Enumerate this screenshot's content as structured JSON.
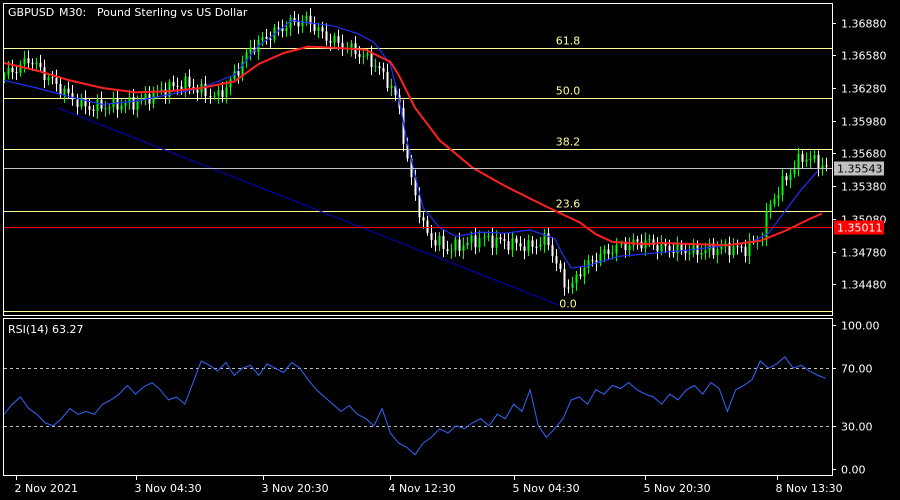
{
  "symbol": "GBPUSD",
  "timeframe": "M30:",
  "description": "Pound Sterling vs US Dollar",
  "colors": {
    "background": "#000000",
    "frame": "#ffffff",
    "bull_candle": "#00ff00",
    "bear_candle": "#ffffff",
    "ma_slow": "#ff2020",
    "ma_fast": "#2030ff",
    "fibonacci": "#ffff99",
    "trendline": "#0000cc",
    "rsi": "#3366ff",
    "bid_line": "#c0c0c0",
    "ask_line": "#ff0000",
    "ask_label_bg": "#ff0000"
  },
  "chart_data": [
    {
      "type": "candlestick",
      "title": "GBPUSD, M30:  Pound Sterling vs US Dollar",
      "ylim": [
        1.342,
        1.3705
      ],
      "y_ticks": [
        "1.36880",
        "1.36580",
        "1.36280",
        "1.35980",
        "1.35680",
        "1.35380",
        "1.35080",
        "1.34780",
        "1.34480"
      ],
      "x_range": [
        0,
        100
      ],
      "close_path": [
        [
          0,
          1.364
        ],
        [
          2,
          1.3648
        ],
        [
          3,
          1.3655
        ],
        [
          5,
          1.364
        ],
        [
          8,
          1.362
        ],
        [
          10,
          1.361
        ],
        [
          13,
          1.3612
        ],
        [
          16,
          1.3615
        ],
        [
          18,
          1.3622
        ],
        [
          20,
          1.3628
        ],
        [
          22,
          1.3632
        ],
        [
          24,
          1.3625
        ],
        [
          26,
          1.362
        ],
        [
          28,
          1.364
        ],
        [
          30,
          1.3665
        ],
        [
          33,
          1.368
        ],
        [
          35,
          1.3688
        ],
        [
          37,
          1.369
        ],
        [
          39,
          1.3675
        ],
        [
          41,
          1.3668
        ],
        [
          43,
          1.366
        ],
        [
          45,
          1.365
        ],
        [
          47,
          1.363
        ],
        [
          48,
          1.361
        ],
        [
          49,
          1.356
        ],
        [
          50,
          1.353
        ],
        [
          51,
          1.35
        ],
        [
          52,
          1.349
        ],
        [
          54,
          1.348
        ],
        [
          56,
          1.3485
        ],
        [
          58,
          1.349
        ],
        [
          60,
          1.3488
        ],
        [
          62,
          1.3485
        ],
        [
          64,
          1.3482
        ],
        [
          66,
          1.349
        ],
        [
          67,
          1.347
        ],
        [
          68,
          1.345
        ],
        [
          69,
          1.3445
        ],
        [
          70,
          1.346
        ],
        [
          72,
          1.3472
        ],
        [
          74,
          1.348
        ],
        [
          76,
          1.3485
        ],
        [
          78,
          1.3487
        ],
        [
          80,
          1.3482
        ],
        [
          82,
          1.348
        ],
        [
          84,
          1.3478
        ],
        [
          86,
          1.348
        ],
        [
          88,
          1.3482
        ],
        [
          90,
          1.348
        ],
        [
          92,
          1.349
        ],
        [
          93,
          1.352
        ],
        [
          95,
          1.3545
        ],
        [
          97,
          1.3565
        ],
        [
          99,
          1.356
        ],
        [
          100,
          1.3554
        ]
      ],
      "ma_slow": [
        [
          0,
          1.3651
        ],
        [
          4,
          1.3644
        ],
        [
          8,
          1.3635
        ],
        [
          12,
          1.3628
        ],
        [
          16,
          1.3624
        ],
        [
          20,
          1.3625
        ],
        [
          24,
          1.3628
        ],
        [
          28,
          1.3634
        ],
        [
          31,
          1.365
        ],
        [
          34,
          1.366
        ],
        [
          37,
          1.3666
        ],
        [
          40,
          1.3665
        ],
        [
          44,
          1.3663
        ],
        [
          47,
          1.3652
        ],
        [
          48,
          1.364
        ],
        [
          50,
          1.361
        ],
        [
          53,
          1.358
        ],
        [
          57,
          1.3555
        ],
        [
          61,
          1.3538
        ],
        [
          65,
          1.3523
        ],
        [
          68,
          1.3512
        ],
        [
          70,
          1.3505
        ],
        [
          72,
          1.3494
        ],
        [
          74,
          1.3487
        ],
        [
          76,
          1.3486
        ],
        [
          78,
          1.3485
        ],
        [
          80,
          1.3486
        ],
        [
          84,
          1.3485
        ],
        [
          88,
          1.3484
        ],
        [
          92,
          1.3488
        ],
        [
          95,
          1.3497
        ],
        [
          98,
          1.3508
        ],
        [
          99.5,
          1.3513
        ]
      ],
      "ma_fast": [
        [
          0,
          1.3635
        ],
        [
          4,
          1.3628
        ],
        [
          8,
          1.362
        ],
        [
          12,
          1.3613
        ],
        [
          16,
          1.3616
        ],
        [
          20,
          1.3622
        ],
        [
          24,
          1.3628
        ],
        [
          28,
          1.364
        ],
        [
          31,
          1.3667
        ],
        [
          33,
          1.3678
        ],
        [
          35,
          1.369
        ],
        [
          37,
          1.3688
        ],
        [
          40,
          1.3685
        ],
        [
          43,
          1.3678
        ],
        [
          45,
          1.367
        ],
        [
          47,
          1.365
        ],
        [
          48,
          1.362
        ],
        [
          49,
          1.358
        ],
        [
          50,
          1.3548
        ],
        [
          51,
          1.3518
        ],
        [
          53,
          1.35
        ],
        [
          55,
          1.3492
        ],
        [
          58,
          1.3496
        ],
        [
          61,
          1.3495
        ],
        [
          64,
          1.3498
        ],
        [
          67,
          1.349
        ],
        [
          68,
          1.3475
        ],
        [
          69,
          1.3463
        ],
        [
          71,
          1.3465
        ],
        [
          73,
          1.347
        ],
        [
          75,
          1.3474
        ],
        [
          78,
          1.3476
        ],
        [
          81,
          1.3478
        ],
        [
          84,
          1.348
        ],
        [
          88,
          1.3484
        ],
        [
          91,
          1.3487
        ],
        [
          93,
          1.3495
        ],
        [
          95,
          1.3515
        ],
        [
          97,
          1.3535
        ],
        [
          99,
          1.3552
        ]
      ],
      "trendline": [
        [
          6.5,
          1.361
        ],
        [
          67.5,
          1.3429
        ]
      ],
      "fibonacci": [
        {
          "label": "61.8",
          "price": 1.3665
        },
        {
          "label": "50.0",
          "price": 1.3619
        },
        {
          "label": "38.2",
          "price": 1.3572
        },
        {
          "label": "23.6",
          "price": 1.3515
        },
        {
          "label": "0.0",
          "price": 1.3424
        }
      ],
      "bid": {
        "price": 1.35543,
        "label": "1.35543"
      },
      "ask": {
        "price": 1.35011,
        "label": "1.35011"
      }
    },
    {
      "type": "line",
      "title": "RSI(14) 63.27",
      "ylim": [
        0,
        100
      ],
      "y_ticks": [
        "100.00",
        "70.00",
        "30.00",
        "0.00"
      ],
      "levels": [
        70,
        30
      ],
      "x_labels": [
        "2 Nov 2021",
        "3 Nov 04:30",
        "3 Nov 20:30",
        "4 Nov 12:30",
        "5 Nov 04:30",
        "5 Nov 20:30",
        "8 Nov 13:30"
      ],
      "x_positions": [
        1.5,
        16,
        31.5,
        47,
        62,
        78,
        94
      ],
      "series": [
        {
          "values": [
            [
              0,
              38
            ],
            [
              1,
              45
            ],
            [
              2,
              50
            ],
            [
              3,
              42
            ],
            [
              4,
              38
            ],
            [
              5,
              32
            ],
            [
              6,
              30
            ],
            [
              7,
              35
            ],
            [
              8,
              42
            ],
            [
              9,
              38
            ],
            [
              10,
              40
            ],
            [
              11,
              38
            ],
            [
              12,
              45
            ],
            [
              13,
              48
            ],
            [
              14,
              52
            ],
            [
              15,
              58
            ],
            [
              16,
              52
            ],
            [
              17,
              57
            ],
            [
              18,
              60
            ],
            [
              19,
              55
            ],
            [
              20,
              48
            ],
            [
              21,
              50
            ],
            [
              22,
              45
            ],
            [
              23,
              60
            ],
            [
              24,
              75
            ],
            [
              25,
              72
            ],
            [
              26,
              68
            ],
            [
              27,
              74
            ],
            [
              28,
              65
            ],
            [
              29,
              70
            ],
            [
              30,
              72
            ],
            [
              31,
              65
            ],
            [
              32,
              73
            ],
            [
              33,
              70
            ],
            [
              34,
              67
            ],
            [
              35,
              74
            ],
            [
              36,
              70
            ],
            [
              37,
              62
            ],
            [
              38,
              55
            ],
            [
              39,
              50
            ],
            [
              40,
              45
            ],
            [
              41,
              40
            ],
            [
              42,
              44
            ],
            [
              43,
              38
            ],
            [
              44,
              35
            ],
            [
              45,
              30
            ],
            [
              46,
              42
            ],
            [
              47,
              25
            ],
            [
              48,
              18
            ],
            [
              49,
              15
            ],
            [
              50,
              10
            ],
            [
              51,
              18
            ],
            [
              52,
              22
            ],
            [
              53,
              28
            ],
            [
              54,
              25
            ],
            [
              55,
              30
            ],
            [
              56,
              28
            ],
            [
              57,
              32
            ],
            [
              58,
              35
            ],
            [
              59,
              30
            ],
            [
              60,
              38
            ],
            [
              61,
              35
            ],
            [
              62,
              45
            ],
            [
              63,
              40
            ],
            [
              64,
              55
            ],
            [
              65,
              30
            ],
            [
              66,
              22
            ],
            [
              67,
              28
            ],
            [
              68,
              35
            ],
            [
              69,
              48
            ],
            [
              70,
              50
            ],
            [
              71,
              45
            ],
            [
              72,
              55
            ],
            [
              73,
              52
            ],
            [
              74,
              58
            ],
            [
              75,
              56
            ],
            [
              76,
              60
            ],
            [
              77,
              55
            ],
            [
              78,
              52
            ],
            [
              79,
              50
            ],
            [
              80,
              45
            ],
            [
              81,
              52
            ],
            [
              82,
              48
            ],
            [
              83,
              55
            ],
            [
              84,
              58
            ],
            [
              85,
              52
            ],
            [
              86,
              60
            ],
            [
              87,
              56
            ],
            [
              88,
              40
            ],
            [
              89,
              55
            ],
            [
              90,
              58
            ],
            [
              91,
              62
            ],
            [
              92,
              75
            ],
            [
              93,
              70
            ],
            [
              94,
              73
            ],
            [
              95,
              78
            ],
            [
              96,
              70
            ],
            [
              97,
              72
            ],
            [
              98,
              68
            ],
            [
              99,
              65
            ],
            [
              100,
              63
            ]
          ]
        }
      ]
    }
  ]
}
